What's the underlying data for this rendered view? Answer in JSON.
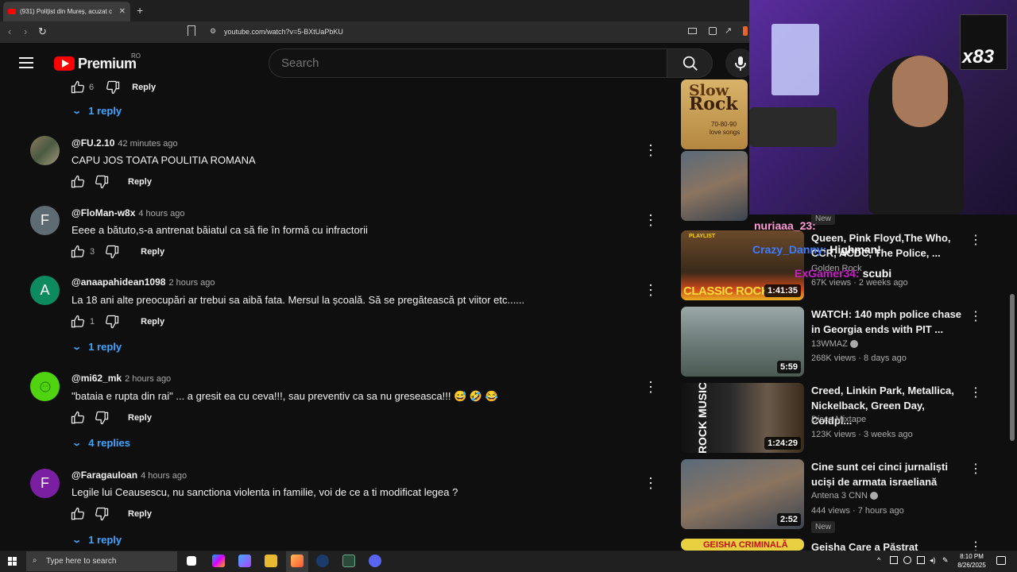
{
  "browser": {
    "tab_title": "(931) Polițist din Mureș, acuzat c",
    "url": "youtube.com/watch?v=5-BXtUaPbKU"
  },
  "header": {
    "logo": "Premium",
    "country": "RO",
    "search_placeholder": "Search"
  },
  "top_partial": {
    "likes": "6",
    "reply": "Reply",
    "replies_link": "1 reply"
  },
  "comments": [
    {
      "author": "@FU.2.10",
      "time": "42 minutes ago",
      "text": "CAPU JOS TOATA POULITIA ROMANA",
      "likes": "",
      "reply": "Reply",
      "replies_link": ""
    },
    {
      "author": "@FloMan-w8x",
      "time": "4 hours ago",
      "text": "Eeee a bătuto,s-a antrenat băiatul ca să fie în formă cu infractorii",
      "likes": "3",
      "reply": "Reply",
      "replies_link": "",
      "avatar_letter": "F"
    },
    {
      "author": "@anaapahidean1098",
      "time": "2 hours ago",
      "text": "La 18 ani alte preocupări ar trebui sa aibă fata. Mersul la școală. Să se pregătească pt viitor etc......",
      "likes": "1",
      "reply": "Reply",
      "replies_link": "1 reply",
      "avatar_letter": "A"
    },
    {
      "author": "@mi62_mk",
      "time": "2 hours ago",
      "text": "\"bataia e rupta din rai\" ... a gresit ea cu ceva!!!, sau preventiv ca sa nu greseasca!!! 😅 🤣 😂",
      "likes": "",
      "reply": "Reply",
      "replies_link": "4 replies"
    },
    {
      "author": "@FaragauIoan",
      "time": "4 hours ago",
      "text": "Legile lui Ceausescu, nu sanctiona violenta in familie, voi de ce a ti modificat legea ?",
      "likes": "",
      "reply": "Reply",
      "replies_link": "1 reply",
      "avatar_letter": "F"
    }
  ],
  "sidebar": {
    "videos": [
      {
        "title": "",
        "channel": "",
        "meta": "",
        "duration": "",
        "thumb_text_1": "Slow",
        "thumb_text_2": "Rock",
        "thumb_text_3": "70-80-90",
        "thumb_text_4": "love songs"
      },
      {
        "title": "",
        "channel": "",
        "meta": "",
        "duration": "",
        "badge": "New"
      },
      {
        "title": "Queen, Pink Floyd,The Who, CCR, ACDC, The Police, ...",
        "channel": "Golden Rock",
        "meta": "67K views · 2 weeks ago",
        "duration": "1:41:35",
        "thumb_text_1": "PLAYLIST",
        "thumb_text_2": "CLASSIC ROCK"
      },
      {
        "title": "WATCH: 140 mph police chase in Georgia ends with PIT ...",
        "channel": "13WMAZ",
        "meta": "268K views · 8 days ago",
        "duration": "5:59"
      },
      {
        "title": "Creed, Linkin Park, Metallica, Nickelback, Green Day, Coldpl...",
        "channel": "Disco Mixtape",
        "meta": "123K views · 3 weeks ago",
        "duration": "1:24:29",
        "thumb_text_1": "ROCK MUSIC"
      },
      {
        "title": "Cine sunt cei cinci jurnaliști uciși de armata israeliană",
        "channel": "Antena 3 CNN",
        "meta": "444 views · 7 hours ago",
        "duration": "2:52",
        "badge": "New"
      },
      {
        "title": "Geisha Care a Păstrat",
        "thumb_text_1": "GEISHA CRIMINALĂ"
      }
    ]
  },
  "overlay": {
    "badge": "x83",
    "chat": [
      {
        "user": "nuriaaa_23:",
        "msg": ""
      },
      {
        "user": "Crazy_Danny:",
        "msg": "Highman!"
      },
      {
        "user": "ExGamer34:",
        "msg": "scubi"
      }
    ]
  },
  "taskbar": {
    "search": "Type here to search",
    "time": "8:10 PM",
    "date": "8/26/2025"
  },
  "colors": {
    "accent": "#3ea6ff",
    "brand": "#ff0000"
  }
}
